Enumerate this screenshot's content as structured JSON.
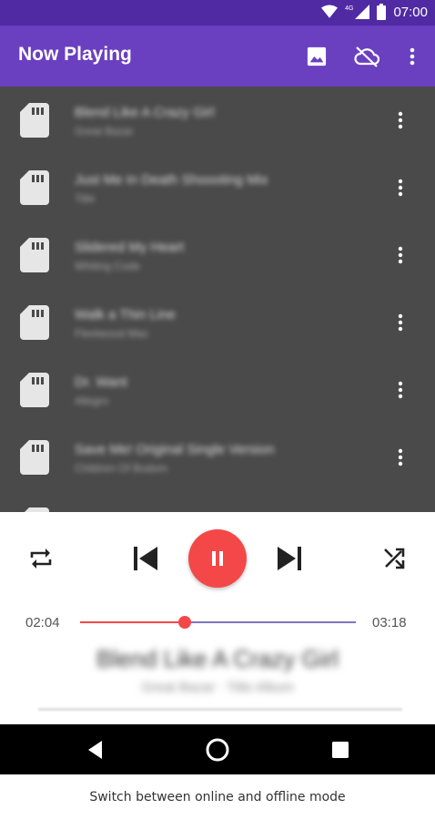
{
  "status_bar": {
    "time": "07:00",
    "network_label": "4G"
  },
  "app_bar": {
    "title": "Now Playing",
    "actions": [
      "image-icon",
      "cloud-off-icon",
      "more-vert-icon"
    ]
  },
  "playlist": {
    "items": [
      {
        "title": "Blend Like A Crazy Girl",
        "subtitle": "Great Bazar",
        "blurred": true
      },
      {
        "title": "Just Me In Death Shoooting Mix",
        "subtitle": "Title",
        "blurred": true
      },
      {
        "title": "Slidered My Heart",
        "subtitle": "Whiting Code",
        "blurred": true
      },
      {
        "title": "Walk a Thin Line",
        "subtitle": "Fleetwood Mac",
        "blurred": true
      },
      {
        "title": "Dr. Want",
        "subtitle": "Allegro",
        "blurred": true
      },
      {
        "title": "Save Me! Original Single Version",
        "subtitle": "Children Of Bodom",
        "blurred": true
      }
    ]
  },
  "player": {
    "elapsed": "02:04",
    "duration": "03:18",
    "progress_fraction": 0.38,
    "now_playing_title": "Blend Like A Crazy Girl",
    "now_playing_subtitle": "Great Bazar · Title Album",
    "state": "playing",
    "accent_color": "#f44848",
    "track_color": "#7e75c2"
  },
  "caption": "Switch between online and offline mode",
  "colors": {
    "status_bar": "#4f2aa3",
    "app_bar": "#6a3fc0",
    "list_bg": "#4a4a4a"
  }
}
